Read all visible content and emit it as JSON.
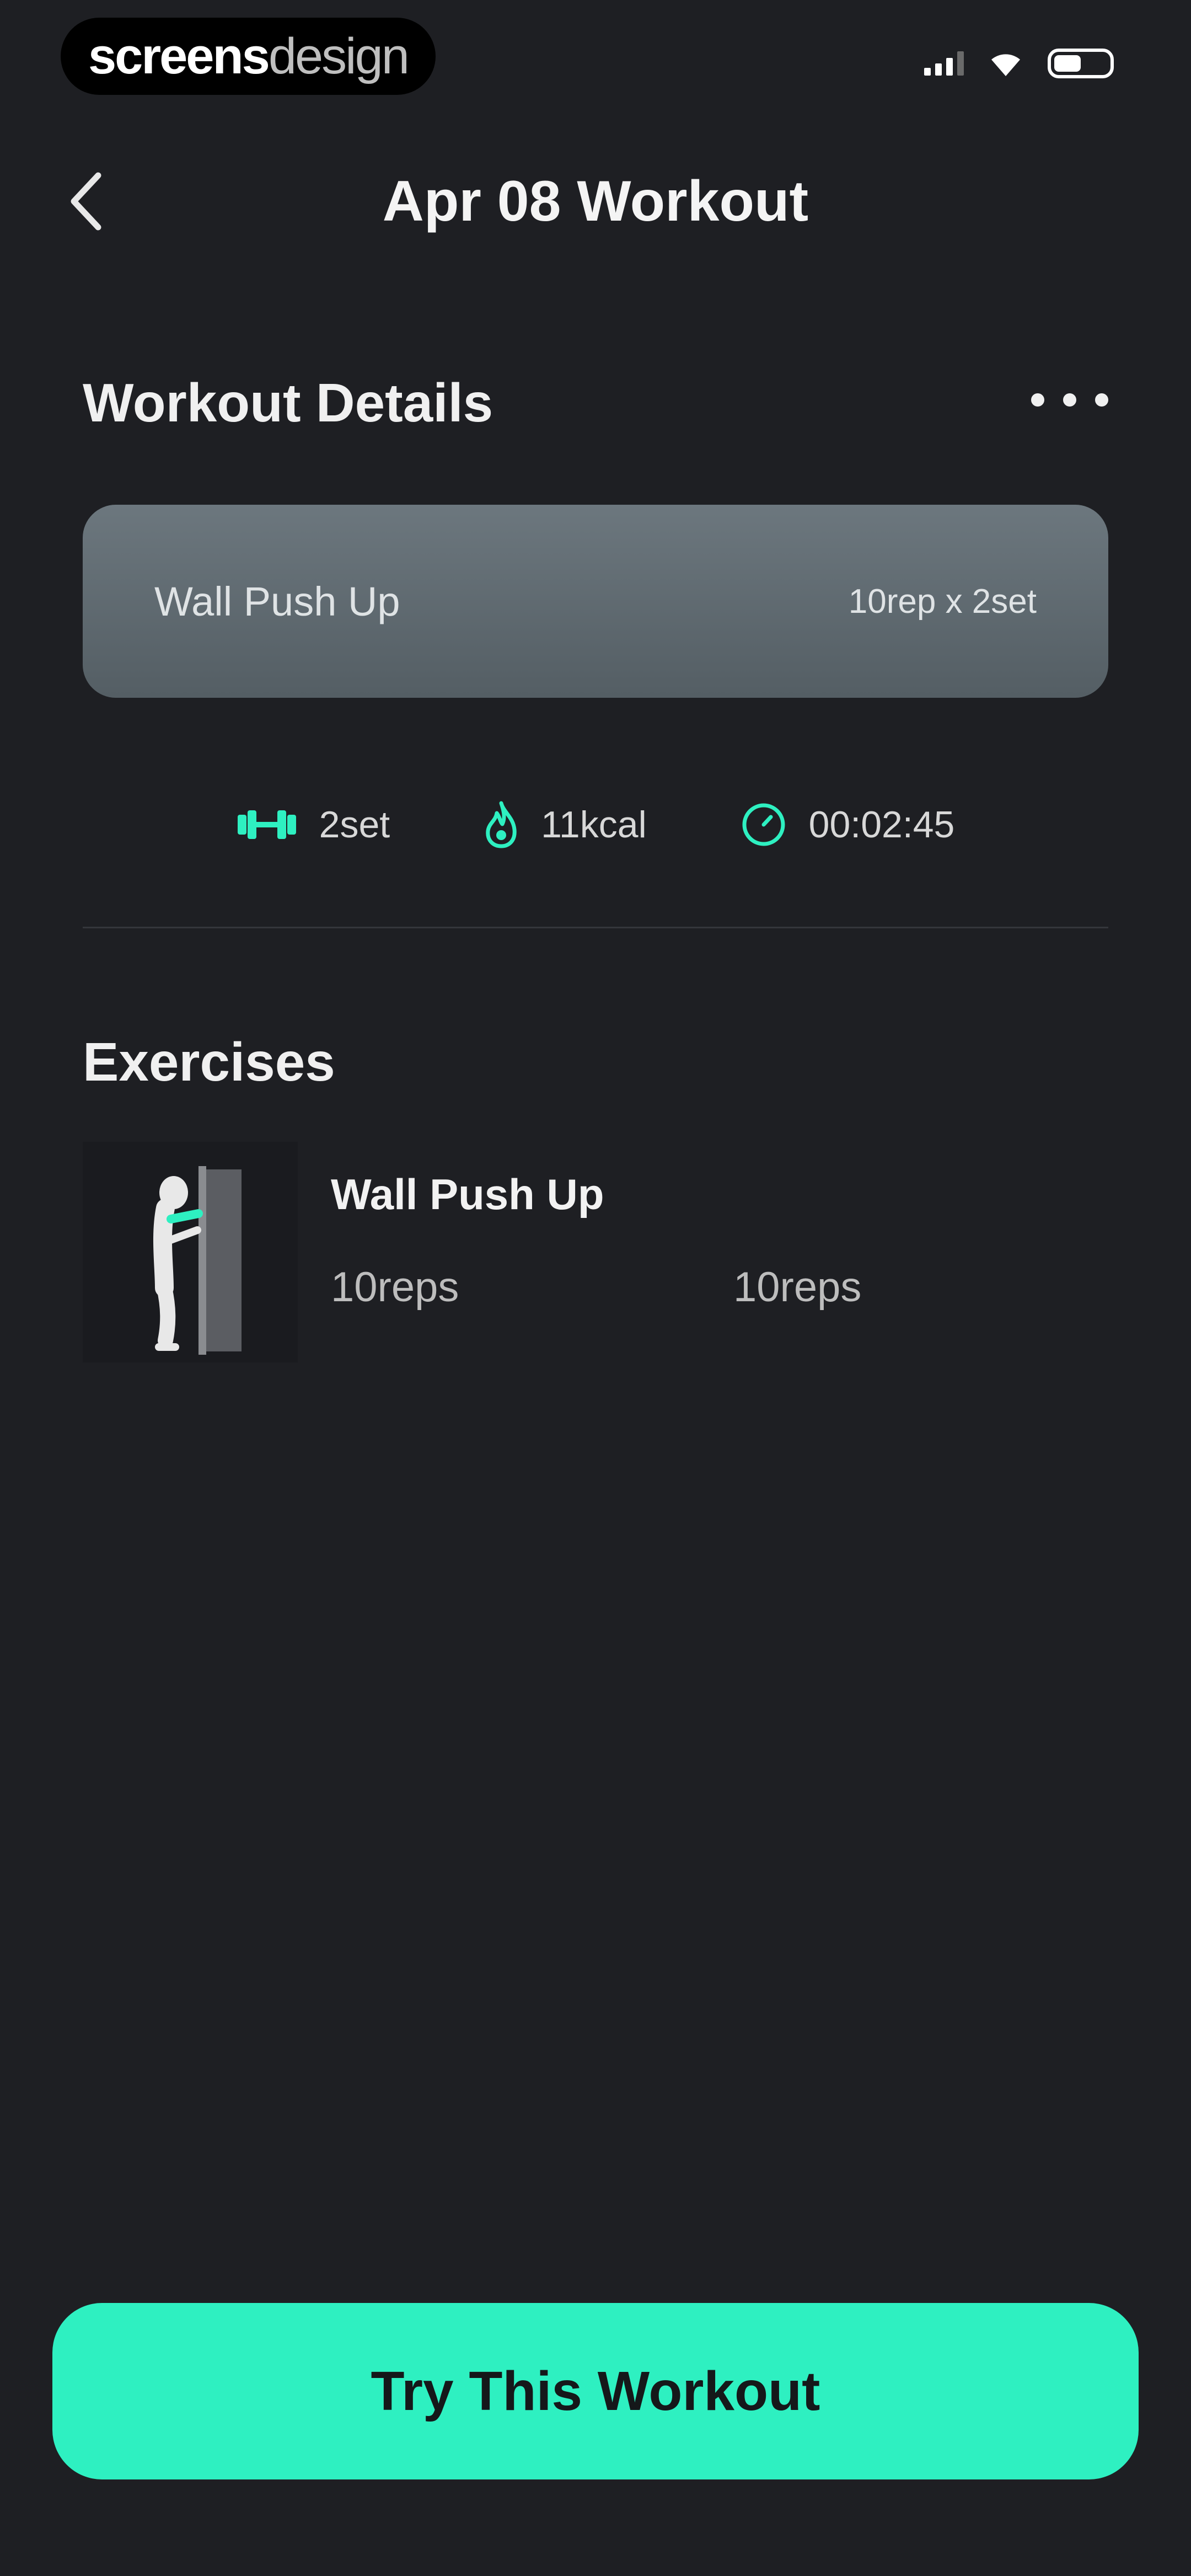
{
  "status_bar": {
    "watermark_strong": "screens",
    "watermark_light": "design",
    "icons": [
      "signal-icon",
      "wifi-icon",
      "battery-icon"
    ]
  },
  "header": {
    "title": "Apr 08 Workout",
    "back_icon": "chevron-left-icon"
  },
  "details": {
    "title": "Workout Details",
    "more_icon": "ellipsis-icon",
    "card": {
      "exercise": "Wall Push Up",
      "sets": "10rep x 2set"
    },
    "stats": [
      {
        "icon": "dumbbell-icon",
        "value": "2set"
      },
      {
        "icon": "flame-icon",
        "value": "11kcal"
      },
      {
        "icon": "timer-icon",
        "value": "00:02:45"
      }
    ]
  },
  "exercises": {
    "title": "Exercises",
    "items": [
      {
        "name": "Wall Push Up",
        "reps": [
          "10reps",
          "10reps"
        ],
        "thumb_icon": "wall-push-up-illustration"
      }
    ]
  },
  "cta": {
    "label": "Try This Workout"
  },
  "colors": {
    "background": "#1e1f23",
    "accent": "#2ef0c1",
    "card": "#5f6a70"
  }
}
